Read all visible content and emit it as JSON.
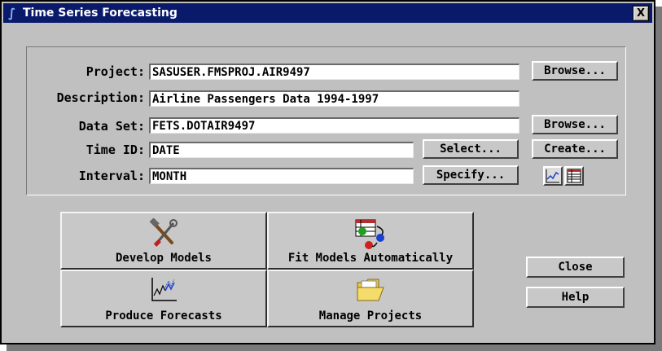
{
  "window": {
    "title": "Time Series Forecasting",
    "close_glyph": "X"
  },
  "form": {
    "project": {
      "label": "Project:",
      "value": "SASUSER.FMSPROJ.AIR9497"
    },
    "description": {
      "label": "Description:",
      "value": "Airline Passengers Data 1994-1997"
    },
    "data_set": {
      "label": "Data Set:",
      "value": "FETS.DOTAIR9497"
    },
    "time_id": {
      "label": "Time ID:",
      "value": "DATE"
    },
    "interval": {
      "label": "Interval:",
      "value": "MONTH"
    },
    "buttons": {
      "browse_project": "Browse...",
      "browse_data_set": "Browse...",
      "select": "Select...",
      "create": "Create...",
      "specify": "Specify..."
    },
    "icons": [
      "line-chart-icon",
      "table-icon"
    ]
  },
  "tasks": [
    {
      "label": "Develop Models",
      "icon": "tools-icon"
    },
    {
      "label": "Fit Models Automatically",
      "icon": "auto-fit-icon"
    },
    {
      "label": "Produce Forecasts",
      "icon": "forecast-chart-icon"
    },
    {
      "label": "Manage Projects",
      "icon": "folder-icon"
    }
  ],
  "actions": {
    "close": "Close",
    "help": "Help"
  },
  "colors": {
    "titlebar": "#0a1a6b",
    "background": "#c0c0c0"
  }
}
